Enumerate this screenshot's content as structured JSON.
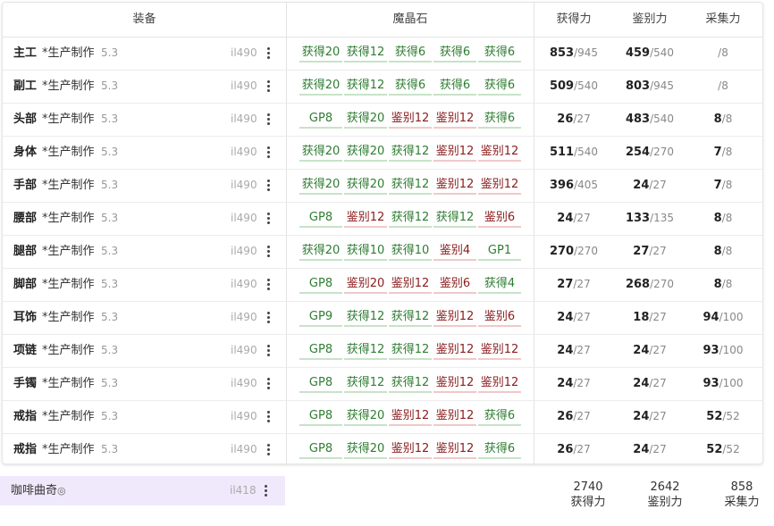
{
  "headers": {
    "equipment": "装备",
    "materia": "魔晶石",
    "gathering": "获得力",
    "perception": "鉴别力",
    "gp": "采集力"
  },
  "rows": [
    {
      "slot": "主工",
      "item": "*生产制作",
      "ver": "5.3",
      "il": "il490",
      "melds": [
        [
          "获得20",
          "g"
        ],
        [
          "获得12",
          "g"
        ],
        [
          "获得6",
          "g"
        ],
        [
          "获得6",
          "g"
        ],
        [
          "获得6",
          "g"
        ]
      ],
      "s1": "853",
      "m1": "/945",
      "s2": "459",
      "m2": "/540",
      "s3": "",
      "m3": "/8"
    },
    {
      "slot": "副工",
      "item": "*生产制作",
      "ver": "5.3",
      "il": "il490",
      "melds": [
        [
          "获得20",
          "g"
        ],
        [
          "获得12",
          "g"
        ],
        [
          "获得6",
          "g"
        ],
        [
          "获得6",
          "g"
        ],
        [
          "获得6",
          "g"
        ]
      ],
      "s1": "509",
      "m1": "/540",
      "s2": "803",
      "m2": "/945",
      "s3": "",
      "m3": "/8"
    },
    {
      "slot": "头部",
      "item": "*生产制作",
      "ver": "5.3",
      "il": "il490",
      "melds": [
        [
          "GP8",
          "g"
        ],
        [
          "获得20",
          "g"
        ],
        [
          "鉴别12",
          "r"
        ],
        [
          "鉴别12",
          "r"
        ],
        [
          "获得6",
          "g"
        ]
      ],
      "s1": "26",
      "m1": "/27",
      "s2": "483",
      "m2": "/540",
      "s3": "8",
      "m3": "/8"
    },
    {
      "slot": "身体",
      "item": "*生产制作",
      "ver": "5.3",
      "il": "il490",
      "melds": [
        [
          "获得20",
          "g"
        ],
        [
          "获得20",
          "g"
        ],
        [
          "获得12",
          "g"
        ],
        [
          "鉴别12",
          "r"
        ],
        [
          "鉴别12",
          "r"
        ]
      ],
      "s1": "511",
      "m1": "/540",
      "s2": "254",
      "m2": "/270",
      "s3": "7",
      "m3": "/8"
    },
    {
      "slot": "手部",
      "item": "*生产制作",
      "ver": "5.3",
      "il": "il490",
      "melds": [
        [
          "获得20",
          "g"
        ],
        [
          "获得20",
          "g"
        ],
        [
          "获得12",
          "g"
        ],
        [
          "鉴别12",
          "r"
        ],
        [
          "鉴别12",
          "r"
        ]
      ],
      "s1": "396",
      "m1": "/405",
      "s2": "24",
      "m2": "/27",
      "s3": "7",
      "m3": "/8"
    },
    {
      "slot": "腰部",
      "item": "*生产制作",
      "ver": "5.3",
      "il": "il490",
      "melds": [
        [
          "GP8",
          "g"
        ],
        [
          "鉴别12",
          "r"
        ],
        [
          "获得12",
          "g"
        ],
        [
          "获得12",
          "g"
        ],
        [
          "鉴别6",
          "r"
        ]
      ],
      "s1": "24",
      "m1": "/27",
      "s2": "133",
      "m2": "/135",
      "s3": "8",
      "m3": "/8"
    },
    {
      "slot": "腿部",
      "item": "*生产制作",
      "ver": "5.3",
      "il": "il490",
      "melds": [
        [
          "获得20",
          "g"
        ],
        [
          "获得10",
          "g"
        ],
        [
          "获得10",
          "g"
        ],
        [
          "鉴别4",
          "r"
        ],
        [
          "GP1",
          "g"
        ]
      ],
      "s1": "270",
      "m1": "/270",
      "s2": "27",
      "m2": "/27",
      "s3": "8",
      "m3": "/8"
    },
    {
      "slot": "脚部",
      "item": "*生产制作",
      "ver": "5.3",
      "il": "il490",
      "melds": [
        [
          "GP8",
          "g"
        ],
        [
          "鉴别20",
          "r"
        ],
        [
          "鉴别12",
          "r"
        ],
        [
          "鉴别6",
          "r"
        ],
        [
          "获得4",
          "g"
        ]
      ],
      "s1": "27",
      "m1": "/27",
      "s2": "268",
      "m2": "/270",
      "s3": "8",
      "m3": "/8"
    },
    {
      "slot": "耳饰",
      "item": "*生产制作",
      "ver": "5.3",
      "il": "il490",
      "melds": [
        [
          "GP9",
          "g"
        ],
        [
          "获得12",
          "g"
        ],
        [
          "获得12",
          "g"
        ],
        [
          "鉴别12",
          "r"
        ],
        [
          "鉴别6",
          "r"
        ]
      ],
      "s1": "24",
      "m1": "/27",
      "s2": "18",
      "m2": "/27",
      "s3": "94",
      "m3": "/100"
    },
    {
      "slot": "项链",
      "item": "*生产制作",
      "ver": "5.3",
      "il": "il490",
      "melds": [
        [
          "GP8",
          "g"
        ],
        [
          "获得12",
          "g"
        ],
        [
          "获得12",
          "g"
        ],
        [
          "鉴别12",
          "r"
        ],
        [
          "鉴别12",
          "r"
        ]
      ],
      "s1": "24",
      "m1": "/27",
      "s2": "24",
      "m2": "/27",
      "s3": "93",
      "m3": "/100"
    },
    {
      "slot": "手镯",
      "item": "*生产制作",
      "ver": "5.3",
      "il": "il490",
      "melds": [
        [
          "GP8",
          "g"
        ],
        [
          "获得12",
          "g"
        ],
        [
          "获得12",
          "g"
        ],
        [
          "鉴别12",
          "r"
        ],
        [
          "鉴别12",
          "r"
        ]
      ],
      "s1": "24",
      "m1": "/27",
      "s2": "24",
      "m2": "/27",
      "s3": "93",
      "m3": "/100"
    },
    {
      "slot": "戒指",
      "item": "*生产制作",
      "ver": "5.3",
      "il": "il490",
      "melds": [
        [
          "GP8",
          "g"
        ],
        [
          "获得20",
          "g"
        ],
        [
          "鉴别12",
          "r"
        ],
        [
          "鉴别12",
          "r"
        ],
        [
          "获得6",
          "g"
        ]
      ],
      "s1": "26",
      "m1": "/27",
      "s2": "24",
      "m2": "/27",
      "s3": "52",
      "m3": "/52"
    },
    {
      "slot": "戒指",
      "item": "*生产制作",
      "ver": "5.3",
      "il": "il490",
      "melds": [
        [
          "GP8",
          "g"
        ],
        [
          "获得20",
          "g"
        ],
        [
          "鉴别12",
          "r"
        ],
        [
          "鉴别12",
          "r"
        ],
        [
          "获得6",
          "g"
        ]
      ],
      "s1": "26",
      "m1": "/27",
      "s2": "24",
      "m2": "/27",
      "s3": "52",
      "m3": "/52"
    }
  ],
  "food": {
    "name": "咖啡曲奇",
    "icon": "hq-icon",
    "glyph": "◎",
    "il": "il418"
  },
  "totals": [
    {
      "value": "2740",
      "label": "获得力"
    },
    {
      "value": "2642",
      "label": "鉴别力"
    },
    {
      "value": "858",
      "label": "采集力"
    }
  ],
  "colors": {
    "gain": "#2e7d32",
    "perception": "#8a1c1c",
    "food_bg": "#efe9fb"
  }
}
